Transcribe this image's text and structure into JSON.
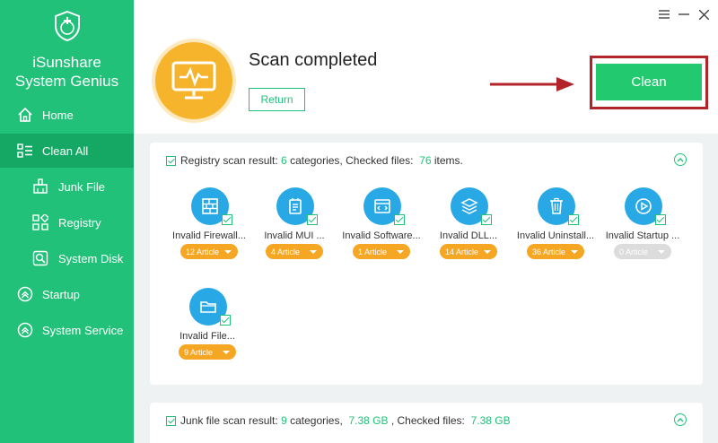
{
  "app": {
    "name_line1": "iSunshare",
    "name_line2": "System Genius"
  },
  "sidebar": {
    "items": [
      {
        "label": "Home",
        "icon": "home-icon"
      },
      {
        "label": "Clean All",
        "icon": "clean-all-icon",
        "active": true
      },
      {
        "label": "Junk File",
        "icon": "broom-icon"
      },
      {
        "label": "Registry",
        "icon": "registry-icon"
      },
      {
        "label": "System Disk",
        "icon": "disk-icon"
      },
      {
        "label": "Startup",
        "icon": "startup-icon"
      },
      {
        "label": "System Service",
        "icon": "service-icon"
      }
    ]
  },
  "header": {
    "scan_title": "Scan completed",
    "return_label": "Return",
    "clean_label": "Clean"
  },
  "registry": {
    "prefix": "Registry scan result: ",
    "categories": "6",
    "mid": " categories, Checked files: ",
    "files": "76",
    "suffix": " items.",
    "items": [
      {
        "label": "Invalid Firewall...",
        "count": "12 Article",
        "icon": "firewall-icon"
      },
      {
        "label": "Invalid MUI ...",
        "count": "4 Article",
        "icon": "document-icon"
      },
      {
        "label": "Invalid Software...",
        "count": "1 Article",
        "icon": "code-window-icon"
      },
      {
        "label": "Invalid DLL...",
        "count": "14 Article",
        "icon": "layers-icon"
      },
      {
        "label": "Invalid Uninstall...",
        "count": "36 Article",
        "icon": "trash-icon"
      },
      {
        "label": "Invalid Startup ...",
        "count": "0 Article",
        "icon": "play-icon"
      },
      {
        "label": "Invalid File...",
        "count": "9 Article",
        "icon": "folder-icon"
      }
    ]
  },
  "junk": {
    "prefix": "Junk file scan result: ",
    "categories": "9",
    "mid": " categories, ",
    "size": "7.38 GB",
    "mid2": " , Checked files: ",
    "files": "7.38 GB"
  },
  "colors": {
    "sidebar": "#22c17a",
    "accent_orange": "#f5a623",
    "item_blue": "#28a9e6",
    "highlight_red": "#b3242a"
  }
}
